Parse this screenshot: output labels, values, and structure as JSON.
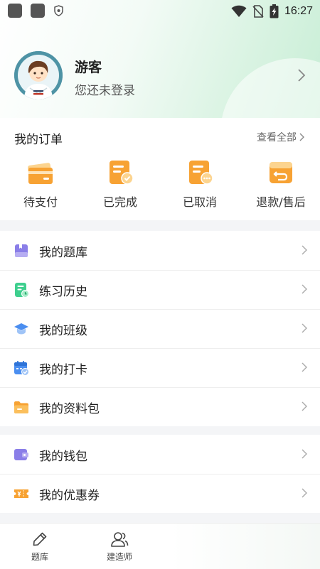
{
  "status_bar": {
    "time": "16:27"
  },
  "profile": {
    "name": "游客",
    "subtitle": "您还未登录"
  },
  "orders": {
    "title": "我的订单",
    "view_all": "查看全部",
    "items": [
      {
        "label": "待支付",
        "icon": "wallet-card-icon"
      },
      {
        "label": "已完成",
        "icon": "order-done-icon"
      },
      {
        "label": "已取消",
        "icon": "order-cancelled-icon"
      },
      {
        "label": "退款/售后",
        "icon": "refund-icon"
      }
    ]
  },
  "menu_group1": [
    {
      "label": "我的题库",
      "icon": "question-bank-icon"
    },
    {
      "label": "练习历史",
      "icon": "practice-history-icon"
    },
    {
      "label": "我的班级",
      "icon": "graduation-cap-icon"
    },
    {
      "label": "我的打卡",
      "icon": "calendar-check-icon"
    },
    {
      "label": "我的资料包",
      "icon": "folder-icon"
    }
  ],
  "menu_group2": [
    {
      "label": "我的钱包",
      "icon": "wallet-icon"
    },
    {
      "label": "我的优惠券",
      "icon": "coupon-icon"
    }
  ],
  "tabbar": [
    {
      "label": "题库",
      "icon": "pencil-icon"
    },
    {
      "label": "建造师",
      "icon": "user-group-icon"
    }
  ],
  "colors": {
    "orange": "#f7a233",
    "green_bg": "#d9f3e2",
    "purple": "#8a7ee8"
  }
}
